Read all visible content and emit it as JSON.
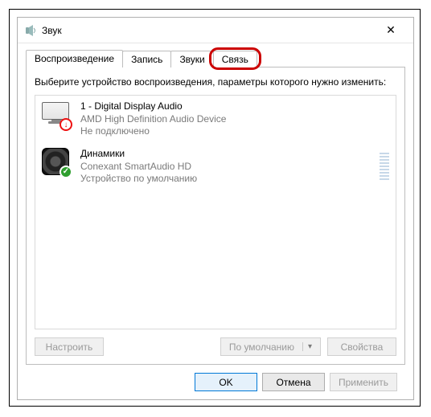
{
  "window": {
    "title": "Звук"
  },
  "tabs": {
    "t0": "Воспроизведение",
    "t1": "Запись",
    "t2": "Звуки",
    "t3": "Связь"
  },
  "instruction": "Выберите устройство воспроизведения, параметры которого нужно изменить:",
  "devices": [
    {
      "name": "1 - Digital Display Audio",
      "driver": "AMD High Definition Audio Device",
      "status": "Не подключено",
      "badge": "down"
    },
    {
      "name": "Динамики",
      "driver": "Conexant SmartAudio HD",
      "status": "Устройство по умолчанию",
      "badge": "ok"
    }
  ],
  "paneButtons": {
    "configure": "Настроить",
    "setDefault": "По умолчанию",
    "properties": "Свойства"
  },
  "dialogButtons": {
    "ok": "OK",
    "cancel": "Отмена",
    "apply": "Применить"
  },
  "icons": {
    "close": "✕",
    "down": "↓",
    "check": "✓"
  }
}
